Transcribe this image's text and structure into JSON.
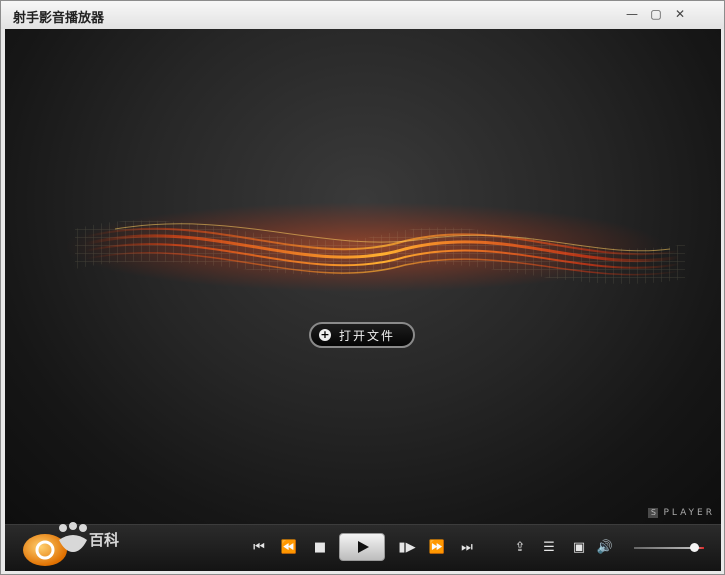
{
  "window": {
    "title": "射手影音播放器",
    "min_icon": "minimize-icon",
    "max_icon": "maximize-icon",
    "close_icon": "close-icon"
  },
  "main": {
    "open_file_label": "打开文件",
    "brand_label": "PLAYER",
    "brand_badge": "S"
  },
  "controls": {
    "volume_level": 0.86,
    "icons": [
      "skip-previous-icon",
      "rewind-icon",
      "stop-icon",
      "play-icon",
      "step-forward-icon",
      "fast-forward-icon",
      "skip-next-icon",
      "open-file-icon",
      "playlist-icon",
      "screen-icon",
      "volume-icon"
    ]
  },
  "watermark": {
    "text": "百科"
  },
  "colors": {
    "accent": "#ff6a1a",
    "background": "#1a1a1a"
  }
}
